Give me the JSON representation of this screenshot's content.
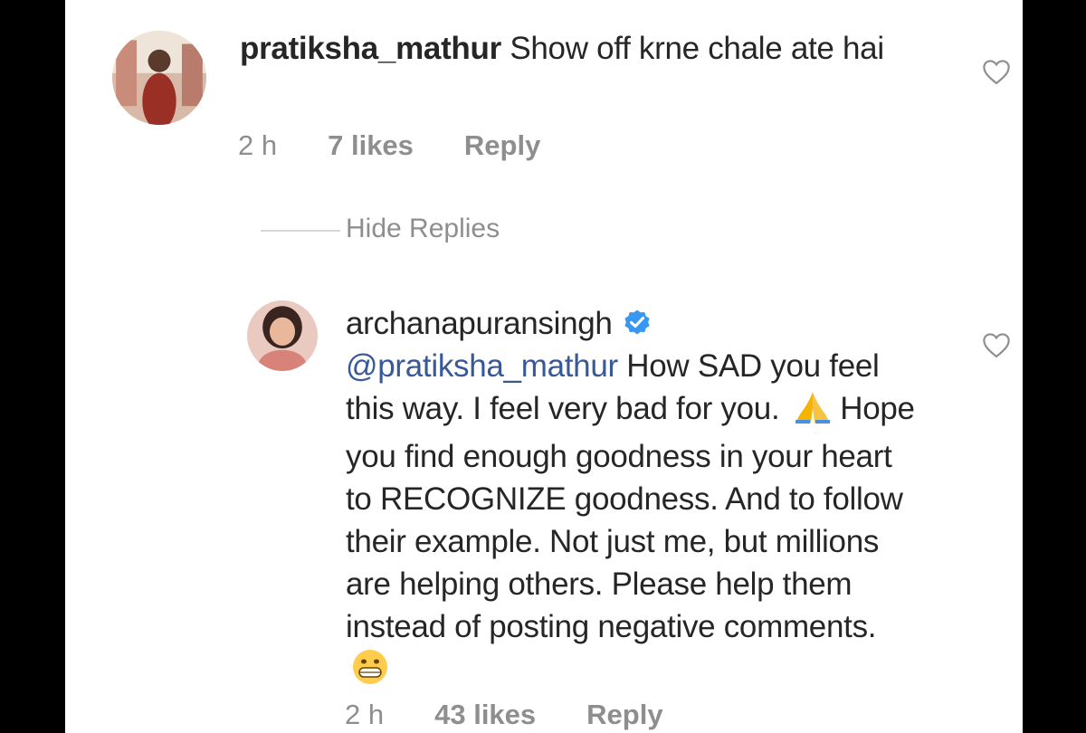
{
  "comment": {
    "username": "pratiksha_mathur",
    "text": "Show off krne chale ate hai",
    "time": "2 h",
    "likes": "7 likes",
    "reply_label": "Reply"
  },
  "thread": {
    "hide_replies_label": "Hide Replies"
  },
  "reply": {
    "username": "archanapuransingh",
    "verified": true,
    "mention": "@pratiksha_mathur",
    "text_part1": "How SAD you feel this way. I feel very bad for you.",
    "emoji1": "folded-hands",
    "text_part2": "Hope you find enough goodness in your heart to RECOGNIZE goodness. And to follow their example. Not just me, but millions are helping others. Please help them instead of posting negative comments.",
    "emoji2": "grinning-face",
    "time": "2 h",
    "likes": "43 likes",
    "reply_label": "Reply"
  },
  "colors": {
    "text": "#262626",
    "meta": "#8e8e8e",
    "verified": "#3897f0",
    "mention": "#385898"
  }
}
